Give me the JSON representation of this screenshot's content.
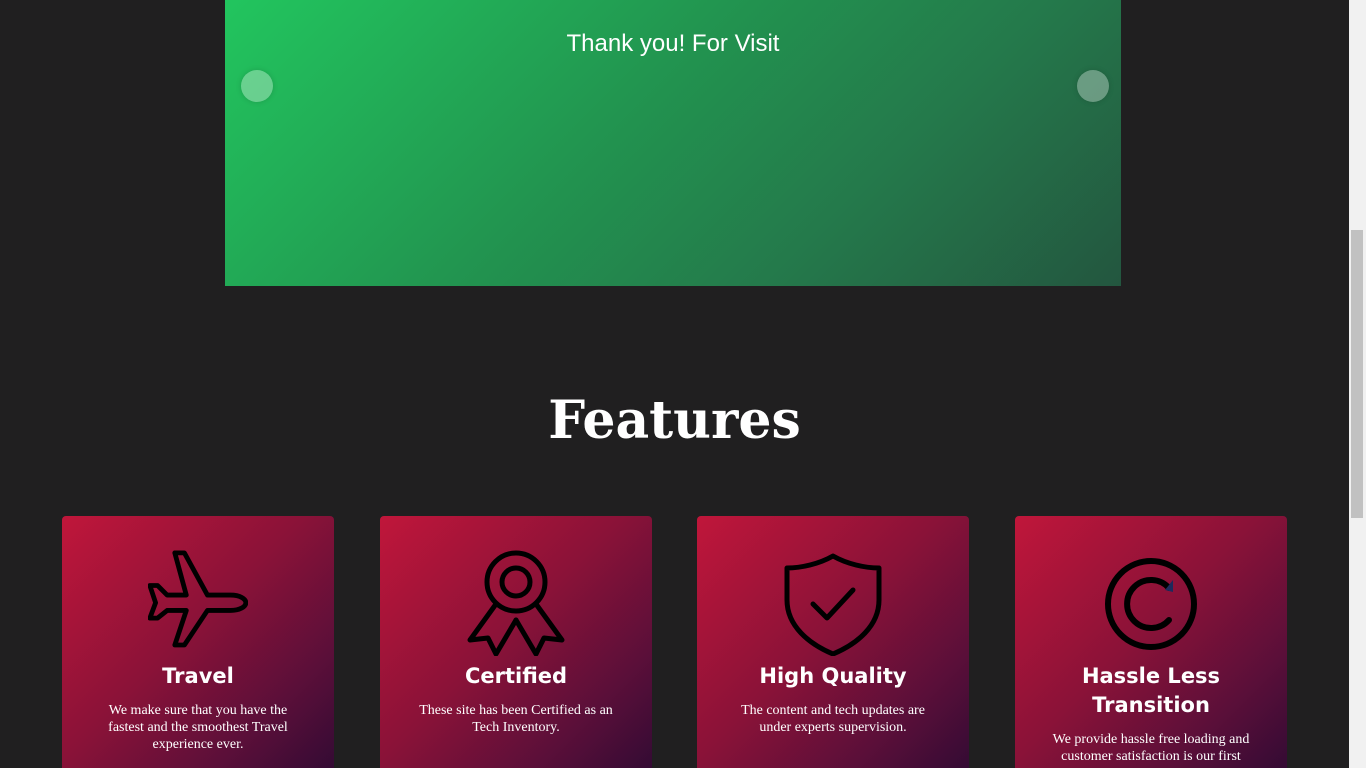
{
  "slider": {
    "caption": "Thank you! For Visit",
    "prev_icon": "circle-arrow-left-icon",
    "next_icon": "circle-arrow-right-icon"
  },
  "features": {
    "title": "Features",
    "cards": [
      {
        "icon": "airplane-icon",
        "title": "Travel",
        "text": "We make sure that you have the fastest and the smoothest Travel experience ever."
      },
      {
        "icon": "award-ribbon-icon",
        "title": "Certified",
        "text": "These site has been Certified as an Tech Inventory."
      },
      {
        "icon": "shield-check-icon",
        "title": "High Quality",
        "text": "The content and tech updates are under experts supervision."
      },
      {
        "icon": "copyright-icon",
        "title": "Hassle Less Transition",
        "text": "We provide hassle free loading and customer satisfaction is our first"
      }
    ]
  },
  "colors": {
    "page_background": "#201f20",
    "slider_gradient_start": "#22c55e",
    "slider_gradient_end": "#23563f",
    "card_gradient_start": "#c0163a",
    "card_gradient_end": "#2e0a33"
  }
}
